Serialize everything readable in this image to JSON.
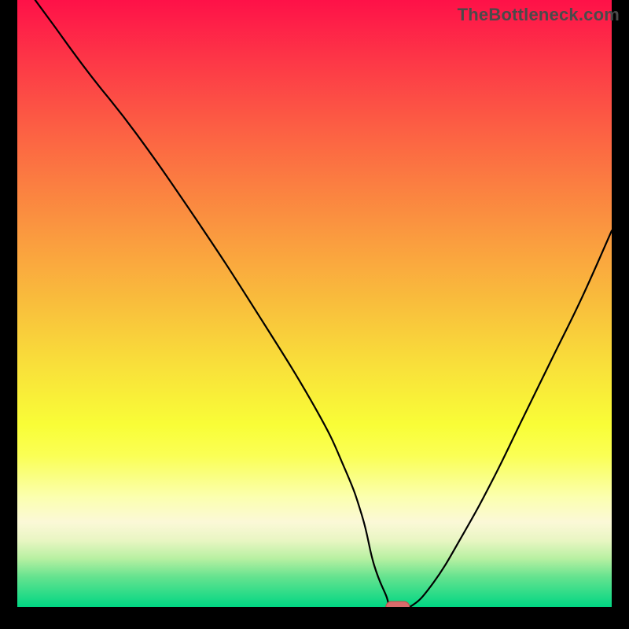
{
  "watermark": "TheBottleneck.com",
  "colors": {
    "curve": "#000000",
    "marker_fill": "#d96b6b",
    "marker_stroke": "#c44848",
    "frame": "#000000"
  },
  "chart_data": {
    "type": "line",
    "title": "",
    "xlabel": "",
    "ylabel": "",
    "xlim": [
      0,
      100
    ],
    "ylim": [
      0,
      100
    ],
    "grid": false,
    "background_gradient": [
      {
        "y_pct": 0,
        "color": "#fe1148"
      },
      {
        "y_pct": 10,
        "color": "#fd3747"
      },
      {
        "y_pct": 20,
        "color": "#fc5b44"
      },
      {
        "y_pct": 30,
        "color": "#fb7d41"
      },
      {
        "y_pct": 40,
        "color": "#fa9e3f"
      },
      {
        "y_pct": 50,
        "color": "#f9be3c"
      },
      {
        "y_pct": 60,
        "color": "#f9df3a"
      },
      {
        "y_pct": 70,
        "color": "#f9fd37"
      },
      {
        "y_pct": 75,
        "color": "#faff54"
      },
      {
        "y_pct": 82,
        "color": "#fbffb0"
      },
      {
        "y_pct": 86,
        "color": "#fbf8d7"
      },
      {
        "y_pct": 89,
        "color": "#e9f6c3"
      },
      {
        "y_pct": 92,
        "color": "#b8f0a2"
      },
      {
        "y_pct": 95,
        "color": "#66e38f"
      },
      {
        "y_pct": 100,
        "color": "#00d683"
      }
    ],
    "series": [
      {
        "name": "bottleneck-curve",
        "x": [
          3,
          6,
          12,
          20,
          30,
          40,
          50,
          55,
          58,
          60,
          62,
          63,
          66,
          70,
          75,
          80,
          85,
          90,
          95,
          100
        ],
        "y": [
          100,
          96,
          88,
          78,
          64,
          49,
          33,
          23,
          15,
          7,
          2,
          0,
          0,
          4,
          12,
          21,
          31,
          41,
          51,
          62
        ]
      }
    ],
    "marker": {
      "x_pct": 64,
      "y_pct": 0,
      "label": "optimal-point"
    }
  }
}
